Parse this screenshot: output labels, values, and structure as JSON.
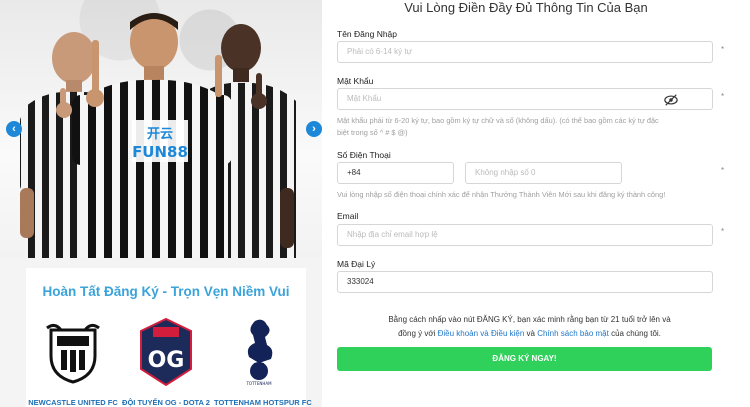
{
  "banner": {
    "sponsor_text_1": "开云",
    "sponsor_text_2": "FUN88"
  },
  "promo": {
    "title": "Hoàn Tất Đăng Ký - Trọn Vẹn Niềm Vui",
    "teams": [
      {
        "name": "NEWCASTLE UNITED FC"
      },
      {
        "name": "ĐỘI TUYỂN OG - DOTA 2"
      },
      {
        "name": "TOTTENHAM HOTSPUR FC"
      }
    ]
  },
  "form": {
    "title": "Vui Lòng Điền Đầy Đủ Thông Tin Của Bạn",
    "username": {
      "label": "Tên Đăng Nhập",
      "placeholder": "Phải có 6-14 ký tự"
    },
    "password": {
      "label": "Mật Khẩu",
      "placeholder": "Mật Khẩu",
      "hint_line1": "Mật khẩu phải từ 6-20 ký tự, bao gồm ký tự chữ và số (không dấu). (có thể bao gồm các ký tự đặc",
      "hint_line2": "biệt trong số ^ # $ @)"
    },
    "phone": {
      "label": "Số Điện Thoại",
      "country_code": "+84",
      "placeholder": "Không nhập số 0",
      "hint": "Vui lòng nhập số điện thoại chính xác để nhận Thưởng Thành Viên Mới sau khi đăng ký thành công!"
    },
    "email": {
      "label": "Email",
      "placeholder": "Nhập địa chỉ email hợp lệ"
    },
    "agent": {
      "label": "Mã Đại Lý",
      "value": "333024"
    },
    "required_mark": "*",
    "terms": {
      "part1": "Bằng cách nhấp vào nút ĐĂNG KÝ, bạn xác minh rằng bạn từ 21 tuổi trở lên và",
      "part2": "đồng ý với",
      "link1": "Điều khoản và Điều kiện",
      "part3": "và",
      "link2": "Chính sách bảo mật",
      "part4": "của chúng tôi."
    },
    "submit_label": "ĐĂNG KÝ NGAY!"
  },
  "colors": {
    "accent_blue": "#1e88d8",
    "submit_green": "#2fd15a",
    "link_blue": "#1f77c9",
    "promo_title": "#3aa3d9"
  }
}
